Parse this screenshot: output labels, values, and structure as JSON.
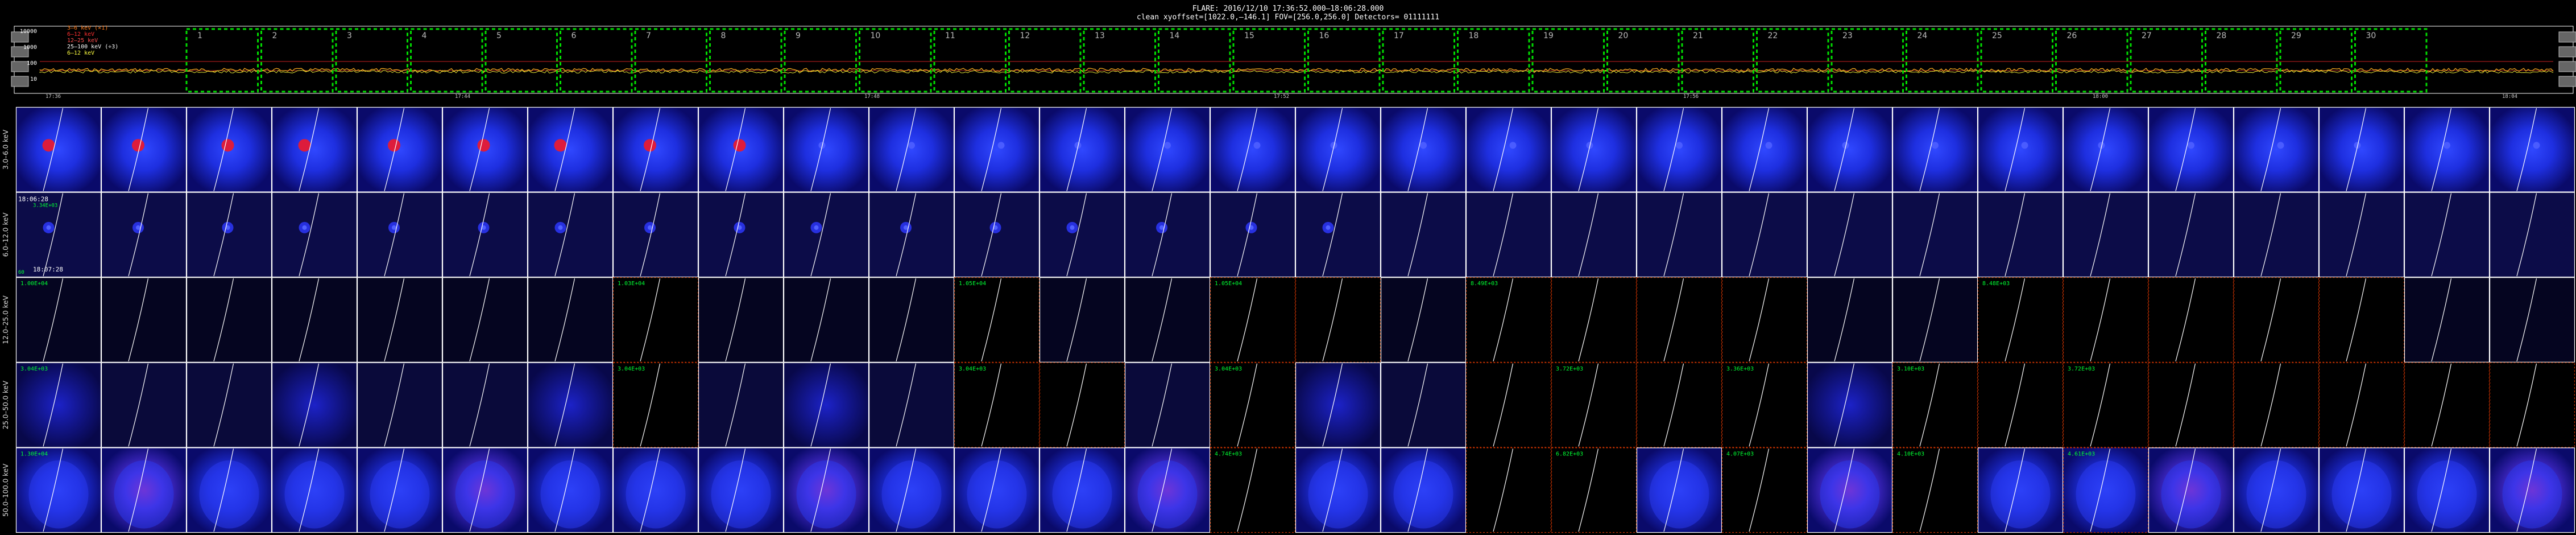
{
  "header": {
    "line1": "FLARE: 2016/12/10  17:36:52.000–18:06:28.000",
    "line2": "clean   xyoffset=[1022.0,–146.1]   FOV=[256.0,256.0]   Detectors= 01111111"
  },
  "lightcurve": {
    "y_ticks": [
      "10000",
      "1000",
      "100",
      "10"
    ],
    "legend": [
      {
        "label": "3–6 keV (×1)",
        "color": "#ff7a1a"
      },
      {
        "label": "6–12 keV",
        "color": "#ff3030"
      },
      {
        "label": "12–25 keV",
        "color": "#ff5050"
      },
      {
        "label": "25–100 keV (÷3)",
        "color": "#ffffff"
      },
      {
        "label": "6–12 keV",
        "color": "#ffff40"
      }
    ],
    "x_ticks": [
      "17:36",
      "17:44",
      "17:48",
      "17:52",
      "17:56",
      "18:00",
      "18:04"
    ],
    "interval_numbers": [
      "1",
      "2",
      "3",
      "4",
      "5",
      "6",
      "7",
      "8",
      "9",
      "10",
      "11",
      "12",
      "13",
      "14",
      "15",
      "16",
      "17",
      "18",
      "19",
      "20",
      "21",
      "22",
      "23",
      "24",
      "25",
      "26",
      "27",
      "28",
      "29",
      "30"
    ]
  },
  "grid": {
    "row_labels": [
      "3.0–6.0 keV",
      "6.0–12.0 keV",
      "12.0–25.0 keV",
      "25.0–50.0 keV",
      "50.0–100.0 keV"
    ],
    "panel_notes": {
      "time_start": "18:06:28",
      "time_end": "18:07:28",
      "row2_first_max": "3.34E+03",
      "row2_first_min": "60"
    },
    "row3_labels": {
      "0": "1.00E+04",
      "7": "1.03E+04",
      "11": "1.05E+04",
      "14": "1.05E+04",
      "17": "8.49E+03",
      "23": "8.48E+03"
    },
    "row4_labels": {
      "0": "3.04E+03",
      "7": "3.04E+03",
      "11": "3.04E+03",
      "14": "3.04E+03",
      "18": "3.72E+03",
      "20": "3.36E+03",
      "22": "3.10E+03",
      "24": "3.72E+03"
    },
    "row5_labels": {
      "0": "1.30E+04",
      "14": "4.74E+03",
      "18": "6.82E+03",
      "20": "4.07E+03",
      "22": "4.10E+03",
      "24": "4.61E+03"
    },
    "black_panels": {
      "2": [
        7,
        11,
        14,
        15,
        17,
        18,
        19,
        20,
        23,
        24,
        25,
        26,
        27
      ],
      "3": [
        7,
        11,
        12,
        14,
        17,
        18,
        19,
        20,
        22,
        23,
        24,
        25,
        26,
        27,
        28,
        29
      ],
      "4": [
        14,
        17,
        18,
        20,
        22
      ]
    }
  },
  "colors": {
    "background": "#000000",
    "green_box": "#00dd00",
    "red_border": "#cc3300",
    "panel_border": "#ffffff",
    "ribbon": "#ffffff"
  }
}
